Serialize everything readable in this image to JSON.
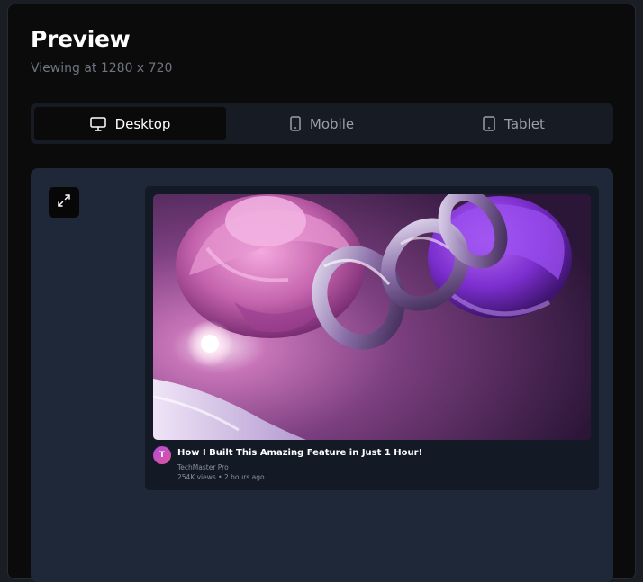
{
  "header": {
    "title": "Preview",
    "subtitle": "Viewing at 1280 x 720"
  },
  "tabs": [
    {
      "label": "Desktop",
      "icon": "monitor-icon",
      "active": true
    },
    {
      "label": "Mobile",
      "icon": "smartphone-icon",
      "active": false
    },
    {
      "label": "Tablet",
      "icon": "tablet-icon",
      "active": false
    }
  ],
  "stage": {
    "expand_icon": "expand-icon"
  },
  "video": {
    "avatar_letter": "T",
    "title": "How I Built This Amazing Feature in Just 1 Hour!",
    "channel": "TechMaster Pro",
    "meta": "254K views • 2 hours ago"
  },
  "colors": {
    "panel_bg": "#0b0b0c",
    "tab_bar_bg": "#161b24",
    "stage_bg": "#1f2838",
    "card_bg": "#131a26",
    "subtitle_text": "#6f7480",
    "avatar_gradient": [
      "#b04bd6",
      "#e0569b"
    ]
  }
}
